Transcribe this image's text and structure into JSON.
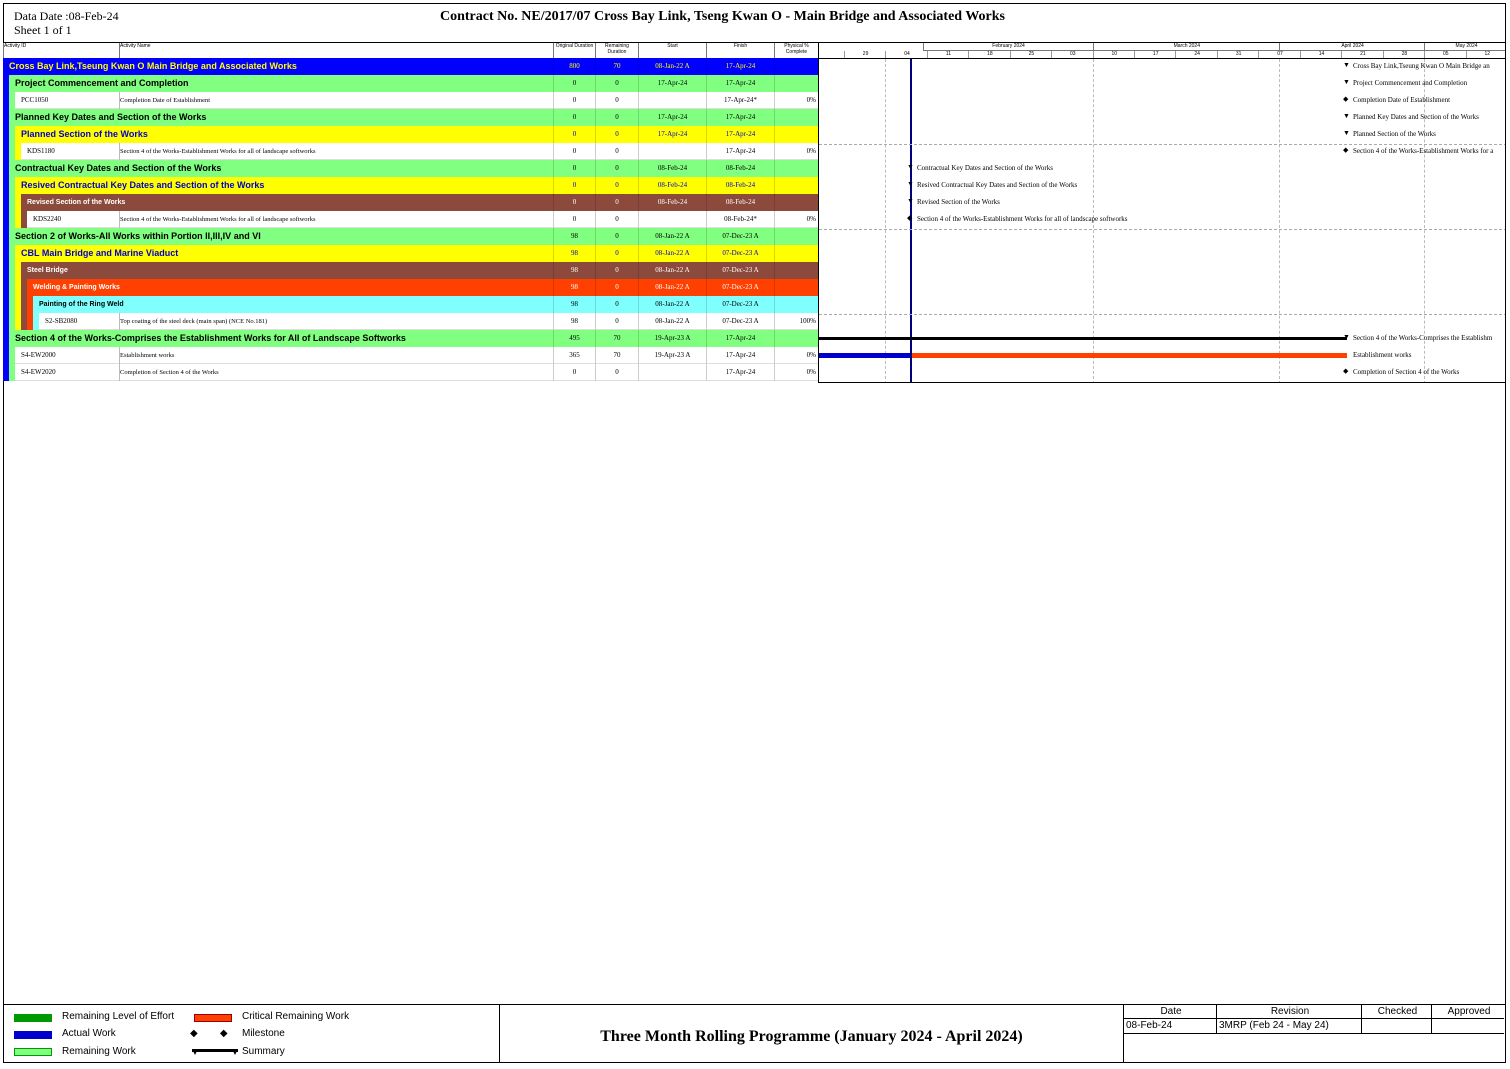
{
  "header": {
    "data_date": "Data Date :08-Feb-24",
    "sheet": "Sheet 1 of 1",
    "title": "Contract  No. NE/2017/07  Cross Bay Link, Tseng Kwan O - Main Bridge and Associated Works"
  },
  "columns": [
    "Activity ID",
    "Activity Name",
    "Original Duration",
    "Remaining Duration",
    "Start",
    "Finish",
    "Physical % Complete"
  ],
  "timeline": {
    "months": [
      "February 2024",
      "March 2024",
      "April 2024",
      "May 2024"
    ],
    "weeks": [
      "29",
      "04",
      "11",
      "18",
      "25",
      "03",
      "10",
      "17",
      "24",
      "31",
      "07",
      "14",
      "21",
      "28",
      "05",
      "12"
    ]
  },
  "rows": [
    {
      "type": "wbs",
      "level": 0,
      "name": "Cross Bay Link,Tseung Kwan O Main Bridge and Associated Works",
      "od": "800",
      "rd": "70",
      "start": "08-Jan-22 A",
      "finish": "17-Apr-24",
      "pct": "",
      "bg": "#0000ff",
      "fg": "#ffff00",
      "gantt": "Cross Bay Link,Tseung Kwan O Main Bridge an"
    },
    {
      "type": "wbs",
      "level": 1,
      "name": "Project Commencement and Completion",
      "od": "0",
      "rd": "0",
      "start": "17-Apr-24",
      "finish": "17-Apr-24",
      "pct": "",
      "bg": "#80ff80",
      "fg": "#000000",
      "gantt": "Project Commencement and Completion"
    },
    {
      "type": "act",
      "level": 2,
      "id": "PCC1050",
      "name": "Completion Date of Establishment",
      "od": "0",
      "rd": "0",
      "start": "",
      "finish": "17-Apr-24*",
      "pct": "0%",
      "gantt": "Completion Date of Establishment"
    },
    {
      "type": "wbs",
      "level": 1,
      "name": "Planned Key Dates and Section of the Works",
      "od": "0",
      "rd": "0",
      "start": "17-Apr-24",
      "finish": "17-Apr-24",
      "pct": "",
      "bg": "#80ff80",
      "fg": "#000000",
      "gantt": "Planned Key Dates and Section of the Works"
    },
    {
      "type": "wbs",
      "level": 2,
      "name": "Planned Section of the Works",
      "od": "0",
      "rd": "0",
      "start": "17-Apr-24",
      "finish": "17-Apr-24",
      "pct": "",
      "bg": "#ffff00",
      "fg": "#0000cc",
      "gantt": "Planned Section of the Works"
    },
    {
      "type": "act",
      "level": 3,
      "id": "KDS1180",
      "name": "Section 4 of the Works-Establishment Works for all of landscape softworks",
      "od": "0",
      "rd": "0",
      "start": "",
      "finish": "17-Apr-24",
      "pct": "0%",
      "gantt": "Section 4 of the Works-Establishment Works for a"
    },
    {
      "type": "wbs",
      "level": 1,
      "name": "Contractual Key Dates and Section of the Works",
      "od": "0",
      "rd": "0",
      "start": "08-Feb-24",
      "finish": "08-Feb-24",
      "pct": "",
      "bg": "#80ff80",
      "fg": "#000000",
      "gantt": "Contractual Key Dates and Section of the Works"
    },
    {
      "type": "wbs",
      "level": 2,
      "name": "Resived Contractual Key Dates and Section of the Works",
      "od": "0",
      "rd": "0",
      "start": "08-Feb-24",
      "finish": "08-Feb-24",
      "pct": "",
      "bg": "#ffff00",
      "fg": "#0000cc",
      "gantt": "Resived Contractual Key Dates and Section of the Works"
    },
    {
      "type": "wbs",
      "level": 3,
      "name": "Revised Section of the Works",
      "od": "0",
      "rd": "0",
      "start": "08-Feb-24",
      "finish": "08-Feb-24",
      "pct": "",
      "bg": "#8b4a3c",
      "fg": "#ffffff",
      "gantt": "Revised Section of the Works"
    },
    {
      "type": "act",
      "level": 4,
      "id": "KDS2240",
      "name": "Section 4 of the Works-Establishment Works for all of landscape softworks",
      "od": "0",
      "rd": "0",
      "start": "",
      "finish": "08-Feb-24*",
      "pct": "0%",
      "gantt": "Section 4 of the Works-Establishment Works for all of landscape softworks"
    },
    {
      "type": "wbs",
      "level": 1,
      "name": "Section 2 of Works-All Works within Portion II,III,IV and VI",
      "od": "98",
      "rd": "0",
      "start": "08-Jan-22 A",
      "finish": "07-Dec-23 A",
      "pct": "",
      "bg": "#80ff80",
      "fg": "#000000",
      "gantt": ""
    },
    {
      "type": "wbs",
      "level": 2,
      "name": "CBL Main Bridge and Marine Viaduct",
      "od": "98",
      "rd": "0",
      "start": "08-Jan-22 A",
      "finish": "07-Dec-23 A",
      "pct": "",
      "bg": "#ffff00",
      "fg": "#0000cc",
      "gantt": ""
    },
    {
      "type": "wbs",
      "level": 3,
      "name": "Steel Bridge",
      "od": "98",
      "rd": "0",
      "start": "08-Jan-22 A",
      "finish": "07-Dec-23 A",
      "pct": "",
      "bg": "#8b4a3c",
      "fg": "#ffffff",
      "gantt": ""
    },
    {
      "type": "wbs",
      "level": 4,
      "name": "Welding & Painting Works",
      "od": "98",
      "rd": "0",
      "start": "08-Jan-22 A",
      "finish": "07-Dec-23 A",
      "pct": "",
      "bg": "#ff4000",
      "fg": "#ffffff",
      "gantt": ""
    },
    {
      "type": "wbs",
      "level": 5,
      "name": "Painting of the Ring Weld",
      "od": "98",
      "rd": "0",
      "start": "08-Jan-22 A",
      "finish": "07-Dec-23 A",
      "pct": "",
      "bg": "#80ffff",
      "fg": "#000000",
      "gantt": ""
    },
    {
      "type": "act",
      "level": 6,
      "id": "S2-SB2080",
      "name": "Top coating of the steel deck (main span) (NCE No.181)",
      "od": "98",
      "rd": "0",
      "start": "08-Jan-22 A",
      "finish": "07-Dec-23 A",
      "pct": "100%",
      "gantt": ""
    },
    {
      "type": "wbs",
      "level": 1,
      "name": "Section 4 of the Works-Comprises the Establishment Works for All of Landscape Softworks",
      "od": "495",
      "rd": "70",
      "start": "19-Apr-23 A",
      "finish": "17-Apr-24",
      "pct": "",
      "bg": "#80ff80",
      "fg": "#000000",
      "gantt": "Section 4 of the Works-Comprises the Establishm"
    },
    {
      "type": "act",
      "level": 2,
      "id": "S4-EW2000",
      "name": "Establishment works",
      "od": "365",
      "rd": "70",
      "start": "19-Apr-23 A",
      "finish": "17-Apr-24",
      "pct": "0%",
      "gantt": "Establishment works"
    },
    {
      "type": "act",
      "level": 2,
      "id": "S4-EW2020",
      "name": "Completion of Section 4 of the Works",
      "od": "0",
      "rd": "0",
      "start": "",
      "finish": "17-Apr-24",
      "pct": "0%",
      "gantt": "Completion of Section 4 of the Works"
    }
  ],
  "legend": {
    "items": [
      {
        "label": "Remaining Level of Effort",
        "color": "#009900"
      },
      {
        "label": "Actual Work",
        "color": "#0000cc"
      },
      {
        "label": "Remaining Work",
        "color": "#80ff80"
      },
      {
        "label": "Critical Remaining Work",
        "color": "#ff4000"
      },
      {
        "label": "Milestone",
        "color": "#000000"
      },
      {
        "label": "Summary",
        "color": "#000000"
      }
    ]
  },
  "footer": {
    "title": "Three Month Rolling Programme (January 2024 - April 2024)",
    "rev_headers": [
      "Date",
      "Revision",
      "Checked",
      "Approved"
    ],
    "rev_values": [
      "08-Feb-24",
      "3MRP (Feb 24 - May 24)",
      "",
      ""
    ]
  }
}
